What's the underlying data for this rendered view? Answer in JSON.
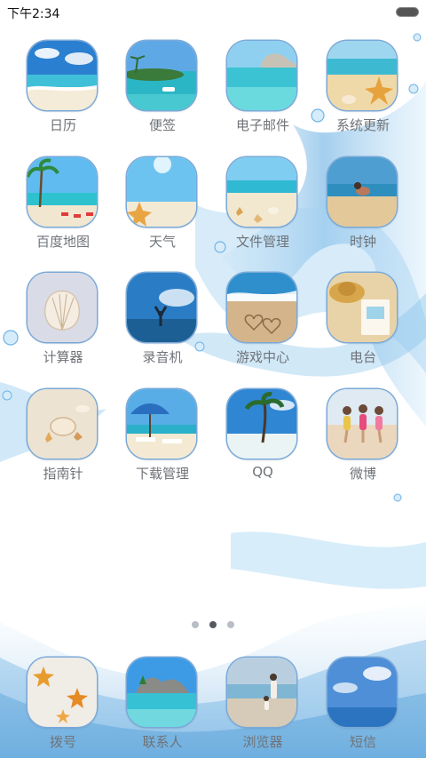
{
  "status_bar": {
    "time": "下午2:34",
    "battery_icon": "battery-icon"
  },
  "apps": [
    {
      "label": "日历",
      "icon": "calendar-beach-icon"
    },
    {
      "label": "便签",
      "icon": "notes-island-icon"
    },
    {
      "label": "电子邮件",
      "icon": "email-lagoon-icon"
    },
    {
      "label": "系统更新",
      "icon": "system-update-starfish-icon"
    },
    {
      "label": "百度地图",
      "icon": "baidu-map-palm-icon"
    },
    {
      "label": "天气",
      "icon": "weather-sky-icon"
    },
    {
      "label": "文件管理",
      "icon": "file-manager-shells-icon"
    },
    {
      "label": "时钟",
      "icon": "clock-beach-icon"
    },
    {
      "label": "计算器",
      "icon": "calculator-shell-icon"
    },
    {
      "label": "录音机",
      "icon": "recorder-silhouette-icon"
    },
    {
      "label": "游戏中心",
      "icon": "game-center-hearts-icon"
    },
    {
      "label": "电台",
      "icon": "radio-hat-icon"
    },
    {
      "label": "指南针",
      "icon": "compass-shells-icon"
    },
    {
      "label": "下载管理",
      "icon": "download-umbrella-icon"
    },
    {
      "label": "QQ",
      "icon": "qq-palm-icon"
    },
    {
      "label": "微博",
      "icon": "weibo-friends-icon"
    }
  ],
  "page_indicator": {
    "pages": 3,
    "current": 2
  },
  "dock": [
    {
      "label": "拨号",
      "icon": "dialer-starfish-icon"
    },
    {
      "label": "联系人",
      "icon": "contacts-rocks-icon"
    },
    {
      "label": "浏览器",
      "icon": "browser-beach-walk-icon"
    },
    {
      "label": "短信",
      "icon": "messages-sky-icon"
    }
  ],
  "colors": {
    "icon_border": "#7aa9d8",
    "label_text": "#6f7378",
    "water_accent": "#5aa7e0"
  }
}
